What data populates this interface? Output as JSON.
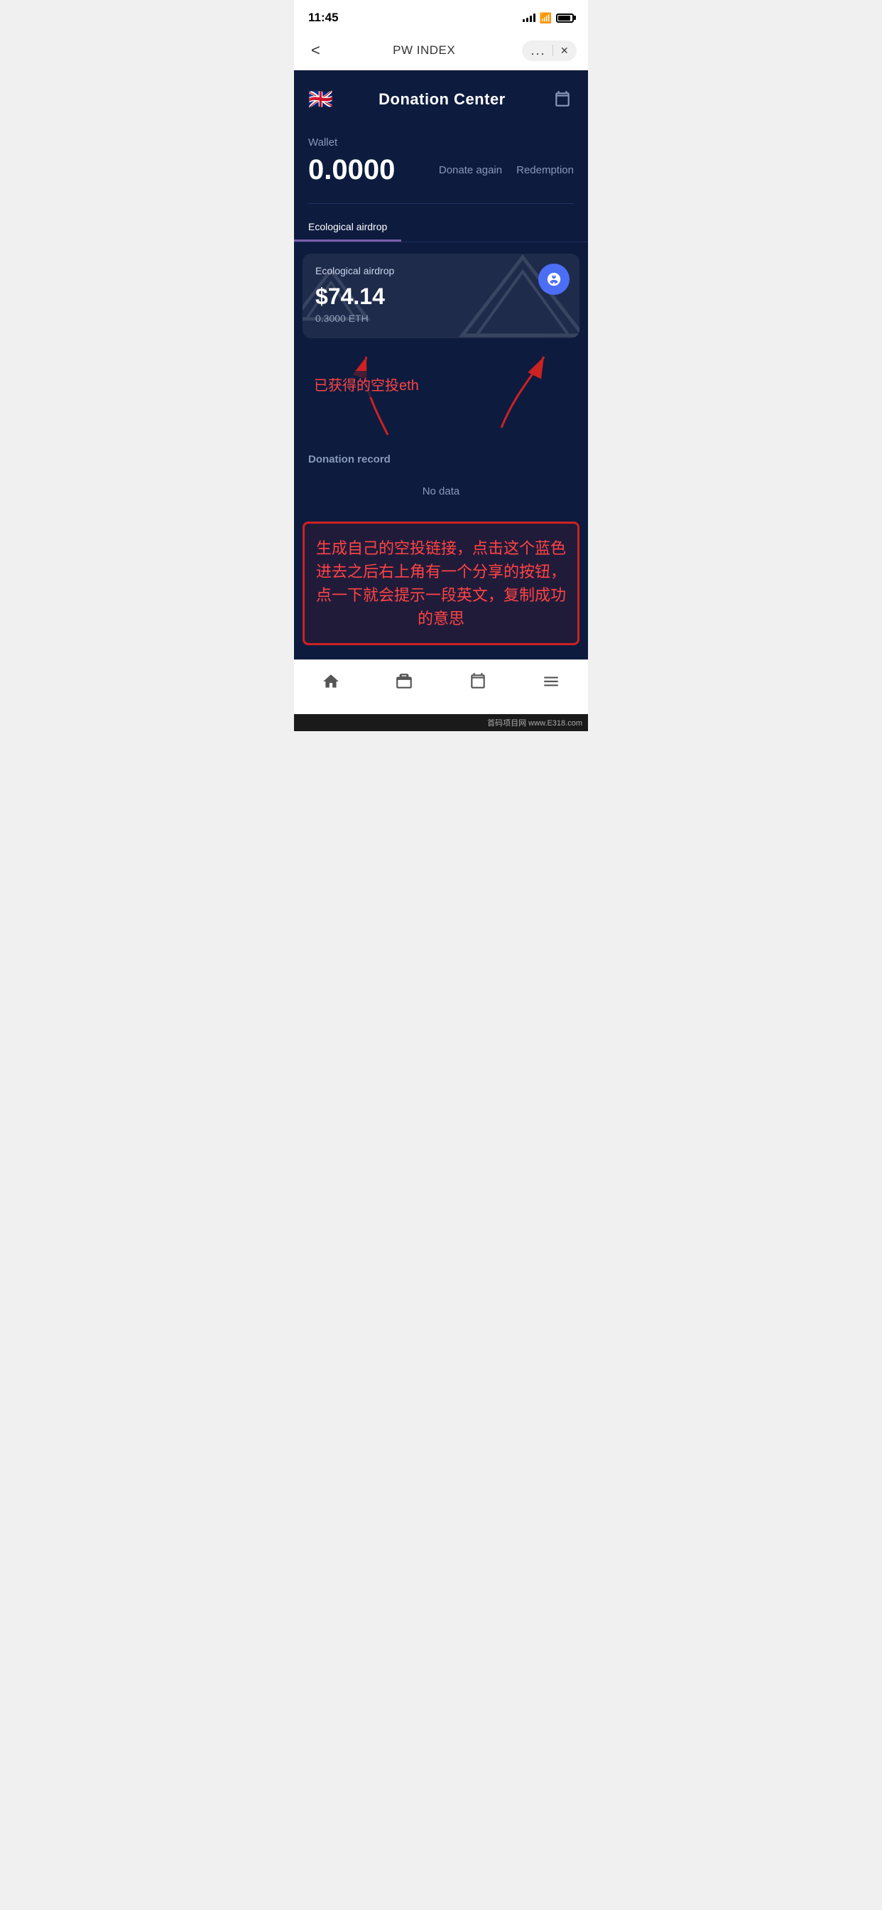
{
  "statusBar": {
    "time": "11:45"
  },
  "navBar": {
    "title": "PW INDEX",
    "backLabel": "<",
    "dotsLabel": "...",
    "closeLabel": "×"
  },
  "header": {
    "flagEmoji": "🇬🇧",
    "title": "Donation Center"
  },
  "wallet": {
    "label": "Wallet",
    "amount": "0.0000",
    "donateAgainLabel": "Donate again",
    "redemptionLabel": "Redemption"
  },
  "tabs": [
    {
      "label": "Ecological airdrop",
      "active": true
    },
    {
      "label": "",
      "active": false
    }
  ],
  "airdropCard": {
    "label": "Ecological airdrop",
    "amount": "$74.14",
    "eth": "0.3000 ETH"
  },
  "annotations": {
    "cnText": "已获得的空投eth",
    "redBoxText": "生成自己的空投链接，点击这个蓝色 进去之后右上角有一个分享的按钮，点一下就会提示一段英文，复制成功的意思"
  },
  "donationRecord": {
    "label": "Donation record",
    "noData": "No data"
  },
  "bottomNav": {
    "homeLabel": "home",
    "briefcaseLabel": "briefcase",
    "calendarLabel": "calendar",
    "menuLabel": "menu"
  },
  "siteLabel": "首码项目网 www.E318.com"
}
